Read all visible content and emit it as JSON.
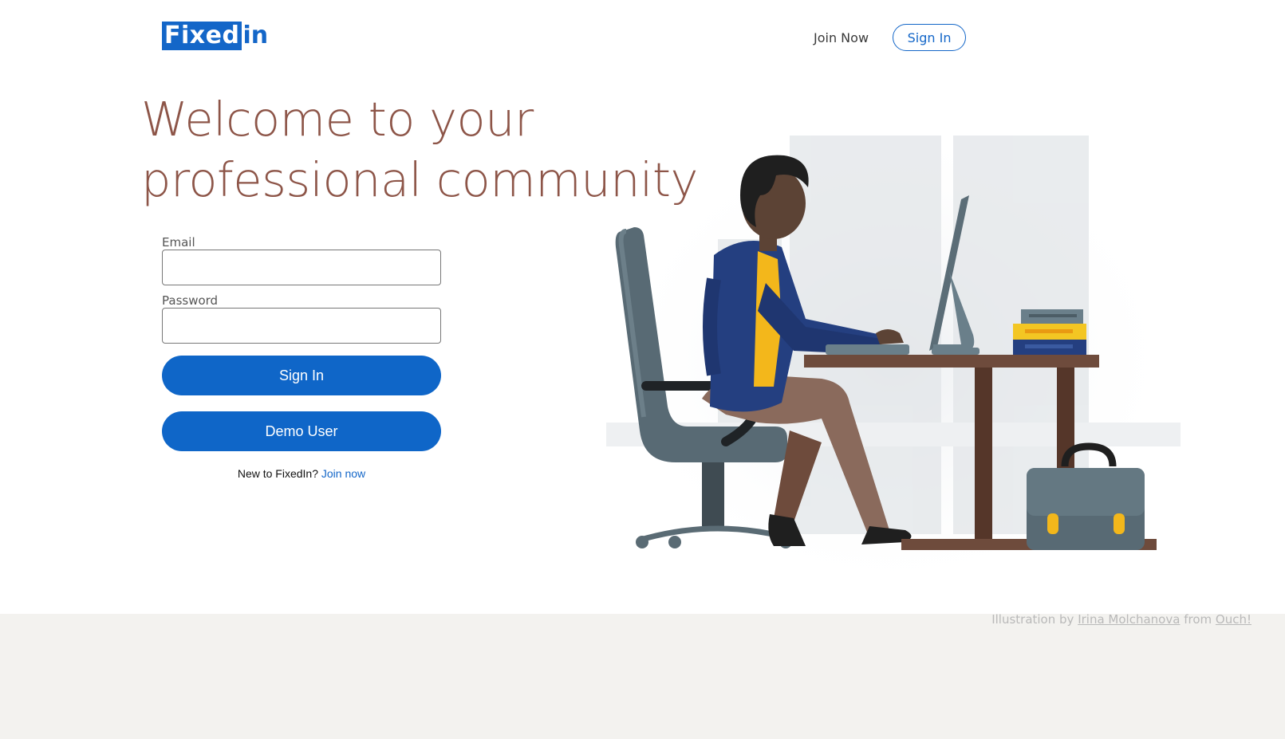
{
  "header": {
    "logo_text": "Fixed",
    "logo_suffix": "in",
    "nav_join": "Join Now",
    "nav_signin": "Sign In"
  },
  "hero": {
    "headline_line1": "Welcome to your",
    "headline_line2": "professional community"
  },
  "form": {
    "email_label": "Email",
    "email_value": "",
    "password_label": "Password",
    "password_value": "",
    "signin_label": "Sign In",
    "demo_label": "Demo User",
    "new_text": "New to FixedIn?",
    "join_link": "Join now"
  },
  "footer": {
    "credit_prefix": "Illustration by",
    "credit_author": "Irina Molchanova",
    "credit_middle": "from",
    "credit_source": "Ouch!"
  },
  "colors": {
    "brand": "#1366c8",
    "headline": "#8d5548",
    "footer_bg": "#f3f2ef"
  }
}
